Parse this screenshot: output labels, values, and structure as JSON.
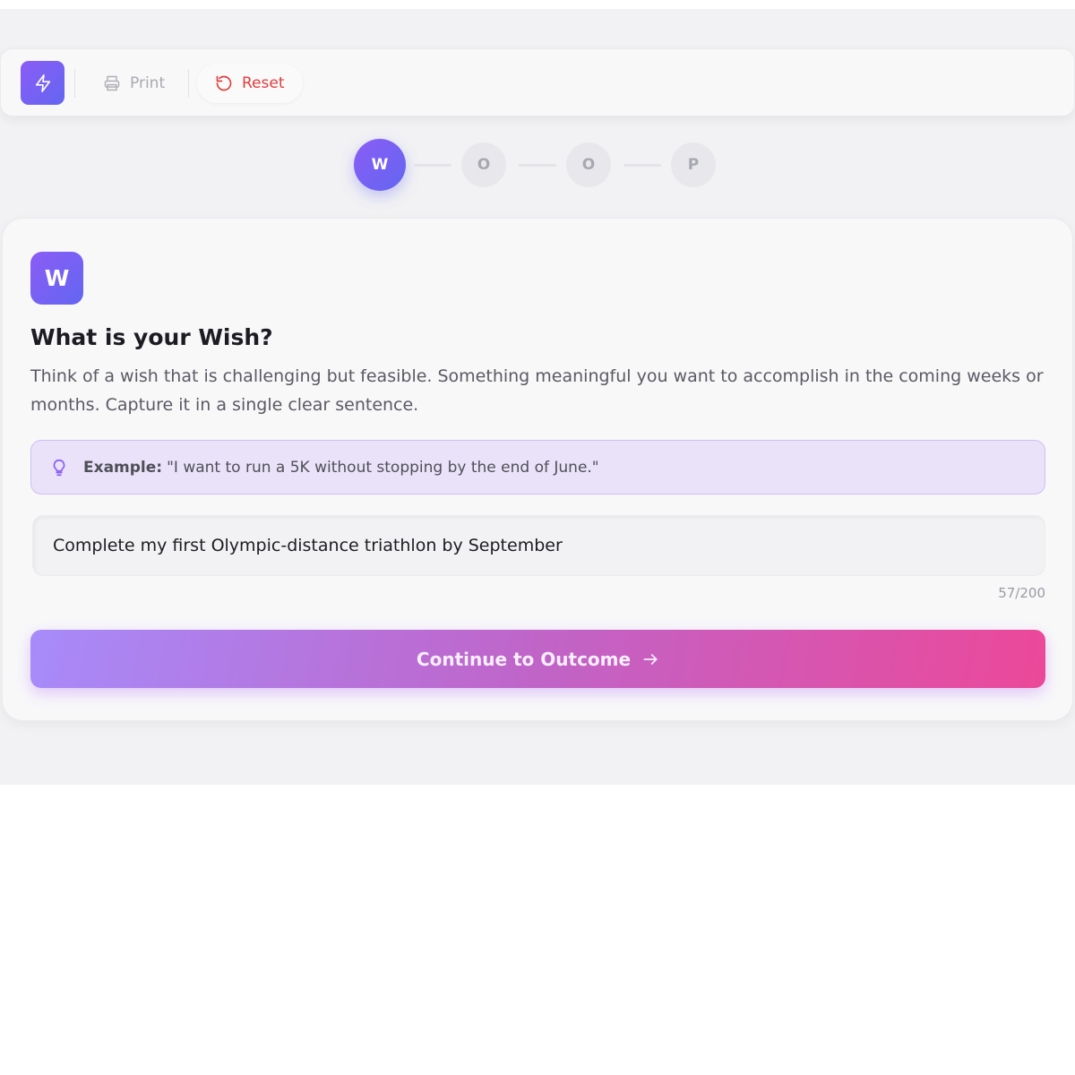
{
  "toolbar": {
    "logo_icon": "lightning-bolt-icon",
    "print_label": "Print",
    "print_icon": "printer-icon",
    "reset_label": "Reset",
    "reset_icon": "undo-icon",
    "reset_color": "#e23c3c"
  },
  "stepper": {
    "steps": [
      {
        "letter": "W",
        "state": "active"
      },
      {
        "letter": "O",
        "state": "inactive"
      },
      {
        "letter": "O",
        "state": "inactive"
      },
      {
        "letter": "P",
        "state": "inactive"
      }
    ]
  },
  "card": {
    "badge_letter": "W",
    "title": "What is your Wish?",
    "description": "Think of a wish that is challenging but feasible. Something meaningful you want to accomplish in the coming weeks or months. Capture it in a single clear sentence.",
    "example_icon": "lightbulb-icon",
    "example_label": "Example:",
    "example_text": "\"I want to run a 5K without stopping by the end of June.\"",
    "input_value": "Complete my first Olympic-distance triathlon by September",
    "char_count": "57/200",
    "continue_label": "Continue to Outcome",
    "continue_icon": "arrow-right-icon"
  },
  "colors": {
    "accent_start": "#8b5cf6",
    "accent_end": "#6366f1",
    "cta_start": "#a78bfa",
    "cta_end": "#ec4899"
  }
}
